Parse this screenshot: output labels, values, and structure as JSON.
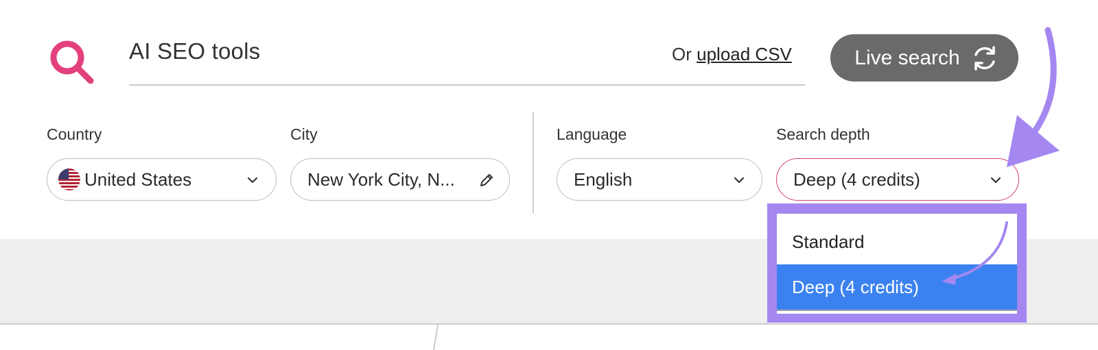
{
  "search": {
    "query": "AI SEO tools",
    "upload_prefix": "Or",
    "upload_link": "upload CSV",
    "live_search_label": "Live search"
  },
  "filters": {
    "country": {
      "label": "Country",
      "value": "United States"
    },
    "city": {
      "label": "City",
      "value": "New York City, N..."
    },
    "language": {
      "label": "Language",
      "value": "English"
    },
    "depth": {
      "label": "Search depth",
      "value": "Deep (4 credits)"
    }
  },
  "depth_options": [
    {
      "label": "Standard",
      "selected": false
    },
    {
      "label": "Deep (4 credits)",
      "selected": true
    }
  ],
  "colors": {
    "accent_pink": "#e2417d",
    "annotation_purple": "#a487f0",
    "selected_blue": "#3b82f0",
    "button_grey": "#6a6a6a"
  },
  "icons": {
    "search": "search-icon",
    "refresh": "refresh-icon",
    "flag": "us-flag-icon",
    "chevron": "chevron-down-icon",
    "edit": "pencil-icon"
  }
}
